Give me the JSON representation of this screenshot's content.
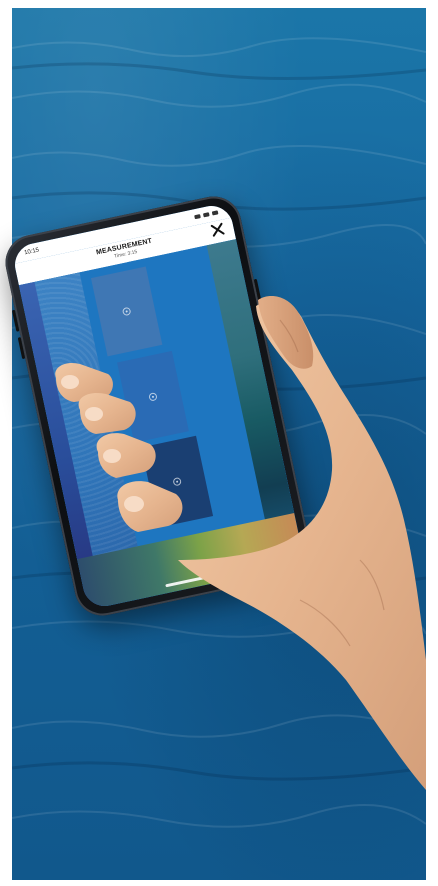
{
  "phone_screen": {
    "status_time": "10:15",
    "header": {
      "title": "MEASUREMENT",
      "subtitle": "Time: 3:15"
    },
    "icons": {
      "close": "close-icon",
      "patch_marker": "target-icon"
    }
  },
  "colors": {
    "ocean": "#1667a0",
    "screen_blue": "#1e76c0",
    "dark_patch": "#1a3f72",
    "skin": "#e8bd9a"
  }
}
